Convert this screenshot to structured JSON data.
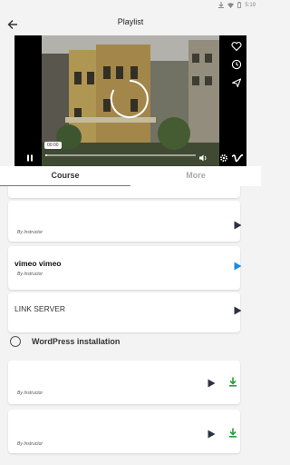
{
  "status": {
    "time": "5:19"
  },
  "header": {
    "title": "Playlist"
  },
  "player": {
    "current_time": "00:00",
    "progress": 0.01
  },
  "tabs": [
    {
      "label": "Course"
    },
    {
      "label": "More"
    }
  ],
  "lessons": [
    {
      "title": "",
      "instructor": "By Instructor"
    },
    {
      "title": "vimeo vimeo",
      "instructor": "By Instructor"
    },
    {
      "title": "LINK SERVER",
      "instructor": ""
    },
    {
      "title": "",
      "instructor": "By Instructor"
    },
    {
      "title": "",
      "instructor": "By Instructor"
    }
  ],
  "section": {
    "label": "WordPress installation"
  },
  "colors": {
    "accent_blue": "#1e88e5",
    "download_green": "#2e9e3c",
    "dark_icon": "#2b3340"
  }
}
